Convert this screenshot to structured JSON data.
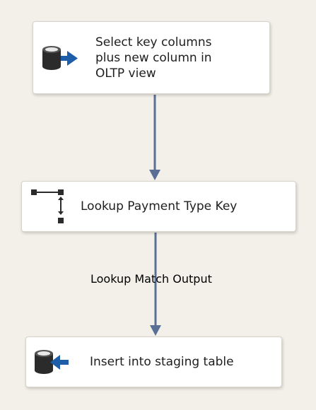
{
  "colors": {
    "canvas_background": "#f3f0e9",
    "connector": "#5a6f96",
    "icon_dark": "#2b2b2b",
    "icon_arrow_blue": "#1e5da8"
  },
  "tasks": {
    "source": {
      "label": "Select key columns\nplus new column in\nOLTP view",
      "icon": "database-source-icon"
    },
    "lookup": {
      "label": "Lookup Payment Type Key",
      "icon": "lookup-icon"
    },
    "destination": {
      "label": "Insert into staging table",
      "icon": "database-destination-icon"
    }
  },
  "paths": {
    "lookup_to_destination": {
      "label": "Lookup Match Output"
    }
  }
}
